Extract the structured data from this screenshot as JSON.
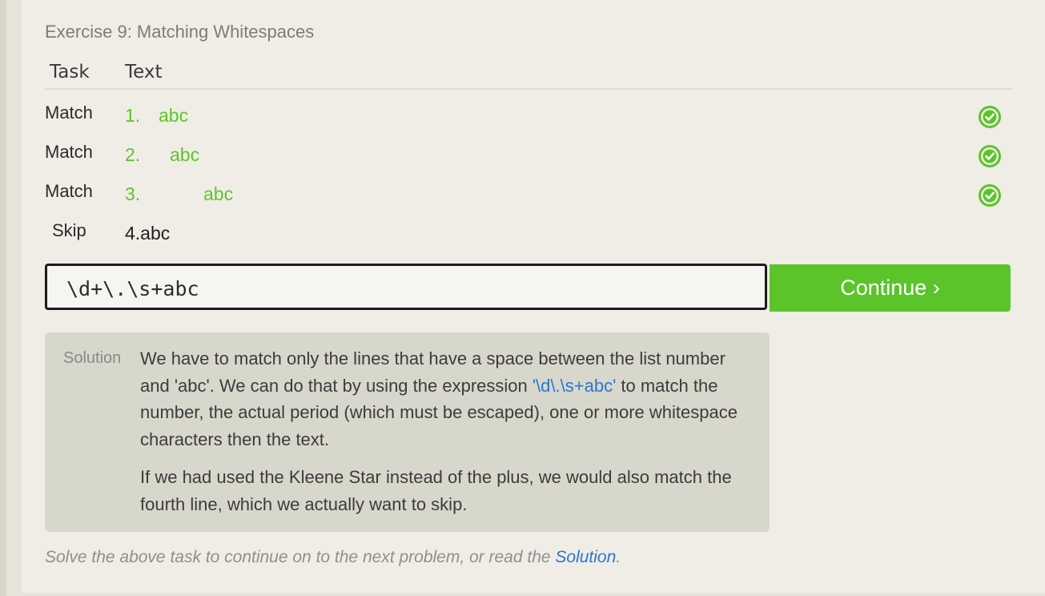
{
  "exercise": {
    "title": "Exercise 9: Matching Whitespaces"
  },
  "table": {
    "headers": {
      "task": "Task",
      "text": "Text"
    },
    "rows": [
      {
        "task": "Match",
        "number": "1.",
        "text": "abc",
        "status": "matched"
      },
      {
        "task": "Match",
        "number": "2.",
        "text": "abc",
        "status": "matched"
      },
      {
        "task": "Match",
        "number": "3.",
        "text": "abc",
        "status": "matched"
      },
      {
        "task": "Skip",
        "number": "",
        "text": "4.abc",
        "status": "none"
      }
    ]
  },
  "input": {
    "value": "\\d+\\.\\s+abc"
  },
  "continue_button": {
    "label": "Continue ›"
  },
  "solution": {
    "label": "Solution",
    "p1_before": "We have to match only the lines that have a space between the list number and 'abc'. We can do that by using the expression ",
    "p1_code": "'\\d\\.\\s+abc'",
    "p1_after": " to match the number, the actual period (which must be escaped), one or more whitespace characters then the text.",
    "p2": "If we had used the Kleene Star instead of the plus, we would also match the fourth line, which we actually want to skip."
  },
  "footer": {
    "text": "Solve the above task to continue on to the next problem, or read the ",
    "link": "Solution",
    "end": "."
  },
  "colors": {
    "accent_green": "#5cc42b",
    "link_blue": "#2a76d2"
  },
  "icons": {
    "row_status": "check-circle-icon"
  }
}
